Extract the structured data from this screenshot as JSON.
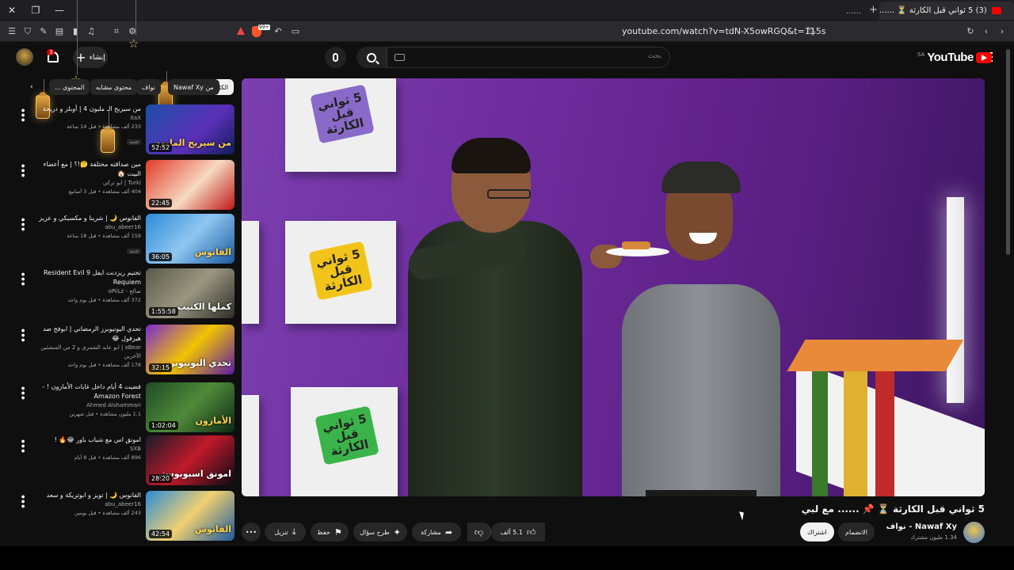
{
  "browser": {
    "tab_title": "(3) 5 ثواني قبل الكارثة ⏳ ......",
    "tab2_title": "......",
    "url": "youtube.com/watch?v=tdN-X5owRGQ&t=115s",
    "brave_badge": "99+"
  },
  "header": {
    "logo_text": "YouTube",
    "country_code": "SA",
    "search_placeholder": "بحث",
    "create_label": "إنشاء",
    "notification_count": "3"
  },
  "chips": [
    {
      "label": "الكل"
    },
    {
      "label": "من Nawaf Xy"
    },
    {
      "label": "نواف"
    },
    {
      "label": "محتوى مشابه"
    },
    {
      "label": "المحتوى ..."
    }
  ],
  "recommendations": [
    {
      "title": "من سيربح الـ مليون 4 | أوبلز و دريحة",
      "channel": "itaX",
      "views": "233 ألف مشاهدة",
      "age": "قبل 14 ساعة",
      "new": "جديد",
      "duration": "52:52",
      "thumb_text": "من سيربح المليون"
    },
    {
      "title": "مين صداقته مختلفة 🤔!؟ | مع أعضاء البيت 🏠",
      "channel": "Turki | ابو تركي",
      "views": "404 ألف مشاهدة",
      "age": "قبل 3 أسابيع",
      "new": "",
      "duration": "22:45",
      "thumb_text": ""
    },
    {
      "title": "الفانوس 🌙 | شرينا و مكسيكي و عزيز",
      "channel": "abu_abeer16",
      "views": "159 ألف مشاهدة",
      "age": "قبل 18 ساعة",
      "new": "جديد",
      "duration": "36:05",
      "thumb_text": "الفانوس"
    },
    {
      "title": "تختيم ريزدنت ايفل Resident Evil 9 Requiem",
      "channel": "صالح - oPiiLz",
      "views": "372 ألف مشاهدة",
      "age": "قبل يوم واحد",
      "new": "",
      "duration": "1:55:58",
      "thumb_text": "كملها الكتيب"
    },
    {
      "title": "تحدي اليوتيوبرز الرمضاني | ابوفح ضد هيرفول 😂",
      "channel": "xBear | ابو عابد الشمري و 2 من المنشئين الآخرين",
      "views": "178 ألف مشاهدة",
      "age": "قبل يوم واحد",
      "new": "",
      "duration": "32:15",
      "thumb_text": "تحدي اليوتيوبرز"
    },
    {
      "title": "قضيت 4 أيام داخل غابات الأمازون ! - Amazon Forest",
      "channel": "Ahmed Alshammari",
      "views": "1.1 مليون مشاهدة",
      "age": "قبل شهرين",
      "new": "",
      "duration": "1:02:04",
      "thumb_text": "الأمازون"
    },
    {
      "title": "امونق اس مع شباب باور 😂🔥 !",
      "channel": "SXB",
      "views": "896 ألف مشاهدة",
      "age": "قبل 8 أيام",
      "new": "",
      "duration": "28:20",
      "thumb_text": "امونق اسبوبوستر"
    },
    {
      "title": "الفانوس 🌙 | تويز و ابوتريكة و سعد",
      "channel": "abu_abeer16",
      "views": "243 ألف مشاهدة",
      "age": "قبل يومين",
      "new": "",
      "duration": "42:54",
      "thumb_text": "الفانوس"
    }
  ],
  "player": {
    "box_text": "5 ثواني قبل الكارثة"
  },
  "video": {
    "title": "5 ثواني قبل الكارثة ⏳ 📌 ...... مع لبي",
    "channel_name": "Nawaf Xy - نواف",
    "subscribers": "1.34 مليون مشترك",
    "join_label": "الانضمام",
    "subscribe_label": "اشتراك",
    "likes": "5.1 ألف",
    "share_label": "مشاركة",
    "ask_label": "طرح سؤال",
    "save_label": "حفظ",
    "download_label": "تنزيل"
  },
  "colors": {
    "background": "#0f0f0f",
    "brand_red": "#ff0000",
    "chip": "#272727"
  }
}
